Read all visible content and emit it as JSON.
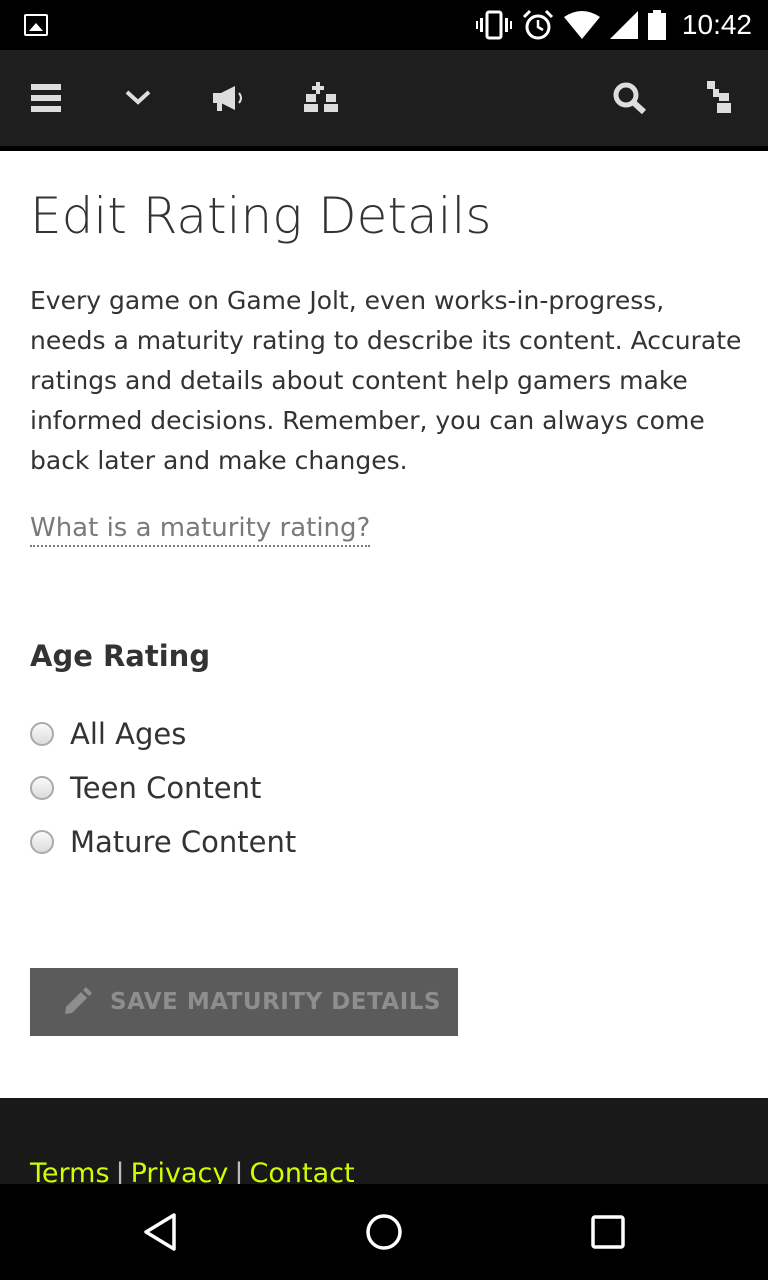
{
  "status_bar": {
    "time": "10:42",
    "icons": [
      "image-icon",
      "vibrate-icon",
      "alarm-icon",
      "wifi-icon",
      "signal-icon",
      "battery-icon"
    ]
  },
  "app_bar": {
    "icons": [
      "menu-icon",
      "chevron-down-icon",
      "megaphone-icon",
      "add-friend-icon",
      "search-icon",
      "user-icon"
    ],
    "background": "#1e1e1e"
  },
  "page": {
    "title": "Edit Rating Details",
    "intro": "Every game on Game Jolt, even works-in-progress, needs a maturity rating to describe its content. Accurate ratings and details about content help gamers make informed decisions. Remember, you can always come back later and make changes.",
    "help_link": "What is a maturity rating?"
  },
  "age_rating": {
    "title": "Age Rating",
    "options": [
      {
        "label": "All Ages",
        "selected": false
      },
      {
        "label": "Teen Content",
        "selected": false
      },
      {
        "label": "Mature Content",
        "selected": false
      }
    ]
  },
  "save_button": {
    "label": "SAVE MATURITY DETAILS",
    "icon": "pencil-icon",
    "disabled": true
  },
  "footer": {
    "links": [
      "Terms",
      "Privacy",
      "Contact"
    ],
    "link_color": "#ccff00"
  },
  "nav_bar": {
    "icons": [
      "back-icon",
      "home-icon",
      "recents-icon"
    ]
  }
}
